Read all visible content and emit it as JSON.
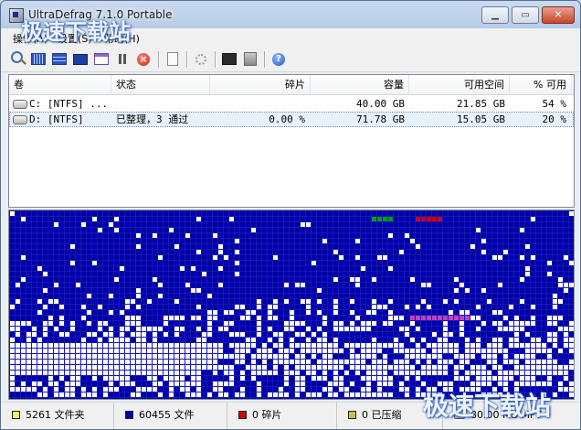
{
  "window": {
    "title": "UltraDefrag 7.1.0 Portable"
  },
  "watermark": {
    "text": "极速下载站"
  },
  "menu": [
    {
      "label": "操作(A)"
    },
    {
      "label": "设置(S)"
    },
    {
      "label": "帮助(H)"
    }
  ],
  "toolbar": [
    {
      "icon": "magnifier-icon",
      "group": 1
    },
    {
      "icon": "defrag-icon",
      "group": 1
    },
    {
      "icon": "quick-optimize-icon",
      "group": 1
    },
    {
      "icon": "full-optimize-icon",
      "group": 1
    },
    {
      "icon": "mft-optimize-icon",
      "group": 1
    },
    {
      "icon": "pause-icon",
      "group": 1
    },
    {
      "icon": "stop-icon",
      "group": 1
    },
    {
      "icon": "report-icon",
      "group": 2
    },
    {
      "icon": "settings-gear-icon",
      "group": 3
    },
    {
      "icon": "boot-time-icon",
      "group": 4
    },
    {
      "icon": "boot-script-icon",
      "group": 4
    },
    {
      "icon": "help-icon",
      "group": 5
    }
  ],
  "columns": {
    "volume": "卷",
    "status": "状态",
    "fragmentation": "碎片",
    "capacity": "容量",
    "free_space": "可用空间",
    "percent_free": "% 可用"
  },
  "volumes": [
    {
      "volume": "C: [NTFS]  ...",
      "status": "",
      "fragmentation": "",
      "capacity": "40.00 GB",
      "free_space": "21.85 GB",
      "percent_free": "54 %",
      "selected": false
    },
    {
      "volume": "D: [NTFS]",
      "status": "已整理，3 通过",
      "fragmentation": "0.00 %",
      "capacity": "71.78 GB",
      "free_space": "15.05 GB",
      "percent_free": "20 %",
      "selected": true
    }
  ],
  "cluster_map": {
    "colors": {
      "free": "#0000aa",
      "used": "#ffffff",
      "fragmented": "#d00000",
      "unmovable": "#00a000",
      "mft": "#c040c0"
    }
  },
  "status": {
    "folders": {
      "text": "5261 文件夹",
      "color": "#f4f46a"
    },
    "files": {
      "text": "60455 文件",
      "color": "#0000aa"
    },
    "fragmented": {
      "text": "0 碎片",
      "color": "#d00000"
    },
    "compressed": {
      "text": "0 已压缩",
      "color": "#c8c04a"
    },
    "mft": {
      "text": "80.00 MB MFT"
    }
  }
}
